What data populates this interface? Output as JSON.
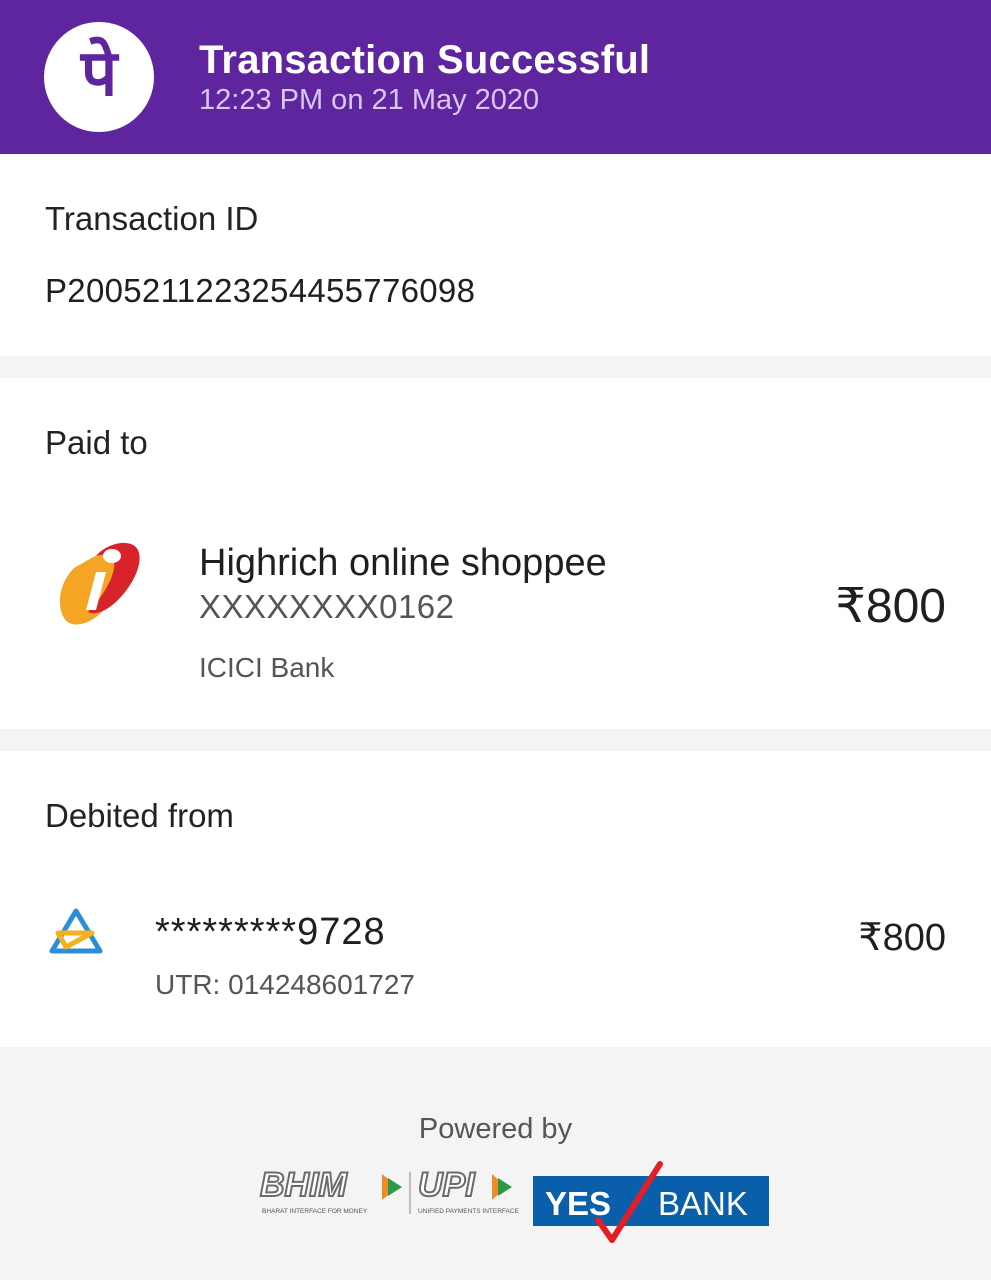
{
  "header": {
    "logo_glyph": "पे",
    "title": "Transaction Successful",
    "datetime": "12:23 PM on 21 May 2020",
    "background_color": "#5f259f"
  },
  "transaction": {
    "label": "Transaction ID",
    "id": "P2005211223254455776098"
  },
  "paid_to": {
    "label": "Paid to",
    "payee_name": "Highrich online shoppee",
    "account": "XXXXXXXX0162",
    "bank": "ICICI Bank",
    "amount": "₹800",
    "logo_icon": "icici-bank-logo-icon"
  },
  "debited_from": {
    "label": "Debited from",
    "account": "*********9728",
    "utr": "UTR: 014248601727",
    "amount": "₹800",
    "logo_icon": "sbi-bank-logo-icon"
  },
  "footer": {
    "powered_by": "Powered by",
    "bhim": "BHIM",
    "bhim_tagline": "BHARAT INTERFACE FOR MONEY",
    "upi": "UPI",
    "upi_tagline": "UNIFIED PAYMENTS INTERFACE",
    "yes": "YES",
    "bank": "BANK",
    "yes_bank_color": "#0a5fab"
  }
}
